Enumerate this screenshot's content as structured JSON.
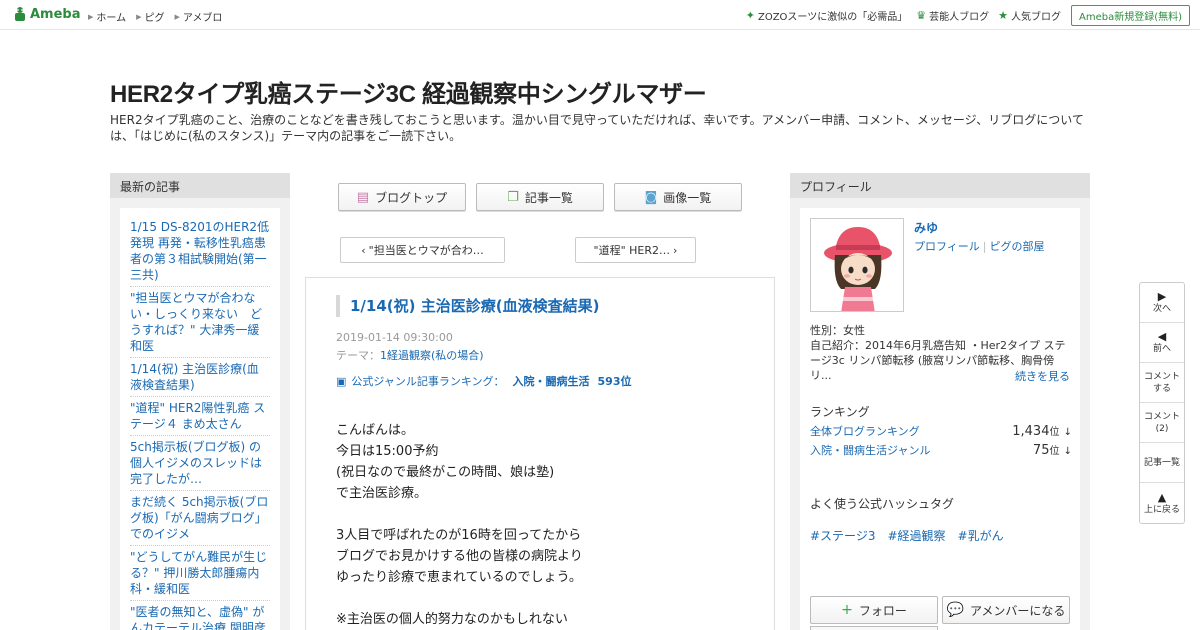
{
  "topbar": {
    "logo_text": "Ameba",
    "nav": [
      "ホーム",
      "ピグ",
      "アメブロ"
    ],
    "right_links": [
      {
        "icon": "sparkle-icon",
        "label": "ZOZOスーツに激似の「必需品」"
      },
      {
        "icon": "crown-icon",
        "label": "芸能人ブログ"
      },
      {
        "icon": "star-icon",
        "label": "人気ブログ"
      }
    ],
    "register_label": "Ameba新規登録(無料)"
  },
  "blog": {
    "title": "HER2タイプ乳癌ステージ3C 経過観察中シングルマザー",
    "description": "HER2タイプ乳癌のこと、治療のことなどを書き残しておこうと思います。温かい目で見守っていただければ、幸いです。アメンバー申請、コメント、メッセージ、リブログについては、「はじめに(私のスタンス)」テーマ内の記事をご一読下さい。"
  },
  "recent": {
    "heading": "最新の記事",
    "items": [
      "1/15 DS-8201のHER2低発現 再発・転移性乳癌患者の第３相試験開始(第一三共)",
      "\"担当医とウマが合わない・しっくり来ない　どうすれば？\" 大津秀一緩和医",
      "1/14(祝) 主治医診療(血液検査結果)",
      "\"道程\" HER2陽性乳癌 ステージ４ まめ太さん",
      "5ch掲示板(ブログ板) の個人イジメのスレッドは完了したが…",
      "まだ続く 5ch掲示板(ブログ板)「がん闘病ブログ」でのイジメ",
      "\"どうしてがん難民が生じる？\" 押川勝太郎腫瘍内科・緩和医",
      "\"医者の無知と、虚偽\" がんカテーテル治療 関明彦"
    ]
  },
  "toolbar": {
    "blog_top": "ブログトップ",
    "entry_list": "記事一覧",
    "image_list": "画像一覧"
  },
  "pager": {
    "prev": "\"担当医とウマが合わ…",
    "next": "\"道程\" HER2…"
  },
  "entry": {
    "title": "1/14(祝) 主治医診療(血液検査結果)",
    "date": "2019-01-14 09:30:00",
    "theme_label": "テーマ：",
    "theme": "1経過観察(私の場合)",
    "ranking_label": "公式ジャンル記事ランキング：",
    "ranking_genre": "入院・闘病生活",
    "ranking_rank": "593位",
    "body": [
      "こんばんは。",
      "今日は15:00予約",
      "(祝日なので最終がこの時間、娘は塾)",
      "で主治医診療。",
      "",
      "3人目で呼ばれたのが16時を回ってたから",
      "ブログでお見かけする他の皆様の病院より",
      "ゆったり診療で恵まれているのでしょう。",
      "",
      "※主治医の個人的努力なのかもしれない"
    ]
  },
  "profile": {
    "heading": "プロフィール",
    "name": "みゆ",
    "link_profile": "プロフィール",
    "link_pig": "ピグの部屋",
    "gender": "性別：女性",
    "intro": "自己紹介：2014年6月乳癌告知 ・Her2タイプ ステージ3c リンパ節転移 (腋窩リンパ節転移、胸骨傍リ...",
    "more": "続きを見る",
    "ranking_heading": "ランキング",
    "rankings": [
      {
        "label": "全体ブログランキング",
        "value": "1,434",
        "unit": "位",
        "arrow": "↓"
      },
      {
        "label": "入院・闘病生活ジャンル",
        "value": "75",
        "unit": "位",
        "arrow": "↓"
      }
    ],
    "hashtag_heading": "よく使う公式ハッシュタグ",
    "hashtags": [
      "#ステージ3",
      "#経過観察",
      "#乳がん"
    ],
    "follow": "フォロー",
    "amember": "アメンバーになる"
  },
  "sidenav": {
    "next": "次へ",
    "prev": "前へ",
    "comment": "コメントする",
    "comments": "コメント(2)",
    "entry_list": "記事一覧",
    "top": "上に戻る"
  },
  "colors": {
    "brand": "#2d8c3c",
    "link": "#1a69b2"
  }
}
